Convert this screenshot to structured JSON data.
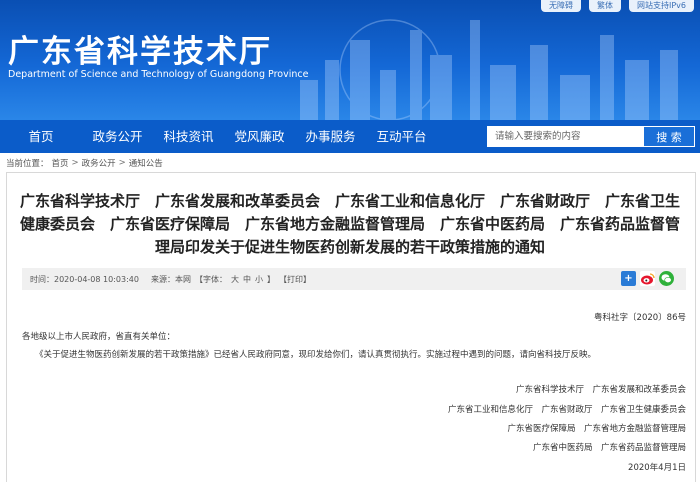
{
  "header": {
    "top_buttons": [
      "无障碍",
      "繁体",
      "网站支持IPv6"
    ],
    "title": "广东省科学技术厅",
    "subtitle": "Department of Science and Technology of Guangdong Province"
  },
  "nav": {
    "items": [
      "首页",
      "政务公开",
      "科技资讯",
      "党风廉政",
      "办事服务",
      "互动平台"
    ],
    "search_placeholder": "请输入要搜索的内容",
    "search_button": "搜 索"
  },
  "breadcrumb": {
    "label": "当前位置：",
    "items": [
      "首页",
      "政务公开",
      "通知公告"
    ],
    "separator": ">"
  },
  "article": {
    "title": "广东省科学技术厅　广东省发展和改革委员会　广东省工业和信息化厅　广东省财政厅　广东省卫生健康委员会　广东省医疗保障局　广东省地方金融监督管理局　广东省中医药局　广东省药品监督管理局印发关于促进生物医药创新发展的若干政策措施的通知",
    "time": "时间：2020-04-08 10:03:40",
    "source": "来源：本网",
    "font_label": "【字体：",
    "font_large": "大",
    "font_medium": "中",
    "font_small": "小",
    "font_close": "】",
    "print": "【打印】",
    "share_icons": [
      "share-plus-icon",
      "weibo-icon",
      "wechat-icon"
    ],
    "doc_number": "粤科社字〔2020〕86号",
    "salutation": "各地级以上市人民政府，省直有关单位：",
    "body": "《关于促进生物医药创新发展的若干政策措施》已经省人民政府同意，现印发给你们，请认真贯彻执行。实施过程中遇到的问题，请向省科技厅反映。",
    "signatories": [
      "广东省科学技术厅　广东省发展和改革委员会",
      "广东省工业和信息化厅　广东省财政厅　广东省卫生健康委员会",
      "广东省医疗保障局　广东省地方金融监督管理局",
      "广东省中医药局　广东省药品监督管理局"
    ],
    "date": "2020年4月1日"
  },
  "colors": {
    "header_blue": "#0a4fb3",
    "nav_blue": "#0b5cc9",
    "search_button": "#1a6fd8",
    "meta_bg": "#f0f0f0"
  }
}
